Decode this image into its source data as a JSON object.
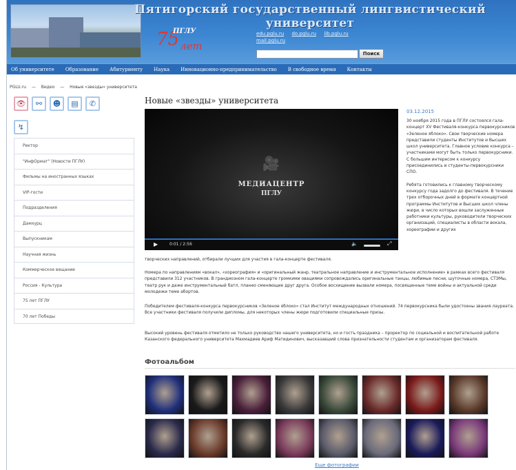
{
  "header": {
    "title": "Пятигорский государственный лингвистический университет",
    "logo_number": "75",
    "logo_word": "лет",
    "logo_abbr": "ПГЛУ",
    "links": [
      "edu.pglu.ru",
      "do.pglu.ru",
      "lib.pglu.ru",
      "mail.pglu.ru"
    ],
    "search_placeholder": "",
    "search_button": "Поиск"
  },
  "nav": [
    "Об университете",
    "Образование",
    "Абитуриенту",
    "Наука",
    "Инновационно-предпринимательство",
    "В свободное время",
    "Контакты"
  ],
  "breadcrumb": [
    "PGLU.ru",
    "—",
    "Видео",
    "—",
    "Новые «звезды» университета"
  ],
  "icons": [
    "eye-icon",
    "sitemap-icon",
    "users-icon",
    "document-icon",
    "phone-icon",
    "lightning-icon"
  ],
  "sidebar": [
    "Ректор",
    "\"ИнфОрмат\" (Новости ПГЛУ)",
    "Фильмы на иностранных языках",
    "VIP-гости",
    "Подразделения",
    "Дамхурц",
    "Выпускникам",
    "Научная жизнь",
    "Коммерческое вещание",
    "Россия - Культура",
    "75 лет ПГЛУ",
    "70 лет Победы"
  ],
  "article": {
    "title": "Новые «звезды» университета",
    "date": "03.12.2015",
    "right_paragraphs": [
      "30 ноября 2015 года в ПГЛУ состоялся гала-концерт XV Фестиваля-конкурса первокурсников «Зеленое яблоко». Свои творческие номера представили студенты Институтов и Высших школ университета. Главное условие конкурса – участниками могут быть только первокурсники. С большим интересом к конкурсу присоединились и студенты-первокурсники СПО.",
      "Ребята готовились к главному творческому конкурсу года задолго до фестиваля. В течение трех отборочных дней в формате концертной программы Институтов и Высших школ члены жюри, в число которых вошли заслуженные работники культуры, руководители творческих организаций, специалисты в области вокала, хореографии и других"
    ],
    "body": [
      "творческих направлений, отбирали лучших для участия в гала-концерте фестиваля.",
      "Номера по направлениям «вокал», «хореография» и «оригинальный жанр, театральное направление и инструментальное исполнение» в рамках всего фестиваля представили 312 участников. В грандиозном гала-концерте громкими овациями сопровождались оригинальные танцы, любимые песни, шуточные номера, СТЭМы, театр рук и даже инструментальный батл, планео сменяющие друг друга. Особое восхищение вызвали номера, посвященные теме войны и актуальной среди молодежи теме абортов.",
      "Победителем фестиваля-конкурса первокурсников «Зеленое яблоко» стал Институт международных отношений. 74 первокурсника были удостоены звания лауреата. Все участники фестиваля получили дипломы, для некоторых члены жюри подготовили специальные призы.",
      "Высокий уровень фестиваля отметило не только руководство нашего университета, но и гость праздника – проректор по социальной и воспитательной работе Казанского федерального университета Махмадиев Ариф Матидинович, высказавший слова признательности студентам и организаторам фестиваля."
    ]
  },
  "video": {
    "brand_line1": "МЕДИАЦЕНТР",
    "brand_line2": "ПГЛУ",
    "time": "0:01 / 2:56",
    "accent": "#2d70c0"
  },
  "photo_album": {
    "heading": "Фотоальбом",
    "more_link": "Еще фотографии",
    "thumb_colors": [
      "#1f2f7a",
      "#1a1a1a",
      "#4a1f3a",
      "#3a3a3a",
      "#3a4a3a",
      "#6a2a2a",
      "#7a1a1a",
      "#5a3a2a",
      "#2a2a4a",
      "#6a3a2a",
      "#2a2a2a",
      "#7a3a5a",
      "#5a5a6a",
      "#6a6a7a",
      "#1a1a5a",
      "#7a3a7a"
    ]
  }
}
